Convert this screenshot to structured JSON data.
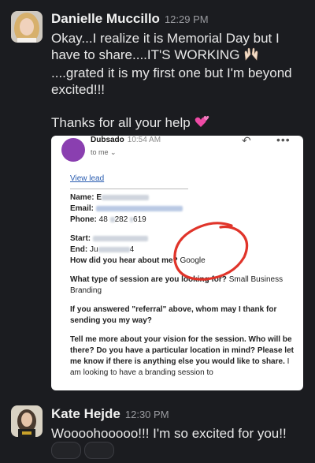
{
  "messages": [
    {
      "sender": "Danielle Muccillo",
      "time": "12:29 PM",
      "lines": [
        "Okay...I realize it is Memorial Day but I",
        "have to share....IT'S WORKING",
        "....grated it is my first one but I'm beyond",
        "excited!!!"
      ],
      "thanks": "Thanks for all your help",
      "emoji_1": "raising-hands",
      "emoji_2": "two-hearts"
    },
    {
      "sender": "Kate Hejde",
      "time": "12:30 PM",
      "text": "Woooohooooo!!! I'm so excited for you!!"
    }
  ],
  "attachment": {
    "from": "Dubsado",
    "time": "10:54 AM",
    "to": "to me",
    "link": "View lead",
    "name_label": "Name:",
    "name_value": "E",
    "email_label": "Email:",
    "phone_label": "Phone:",
    "phone_value": "48",
    "phone_value2": "282",
    "phone_value3": "619",
    "start_label": "Start:",
    "end_label": "End:",
    "end_value": "Ju",
    "end_value2": "4",
    "hear_label": "How did you hear about me?",
    "hear_value": "Google",
    "session_q": "What type of session are you looking for?",
    "session_a": "Small Business Branding",
    "referral_q": "If you answered \"referral\" above, whom may I thank for sending you my way?",
    "vision_q": "Tell me more about your vision for the session. Who will be there? Do you have a particular location in mind? Please let me know if there is anything else you would like to share.",
    "vision_a": "I am looking to have a branding session to"
  },
  "colors": {
    "background": "#1b1c20",
    "annotation": "#e0342a",
    "link": "#2a5db0"
  }
}
